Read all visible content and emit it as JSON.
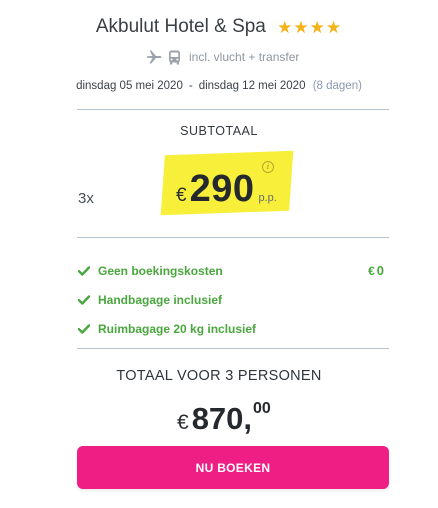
{
  "hotel": {
    "name": "Akbulut Hotel & Spa",
    "stars": 4
  },
  "transport": {
    "icons": [
      "plane-icon",
      "bus-icon"
    ],
    "text": "incl. vlucht + transfer"
  },
  "dates": {
    "from": "dinsdag 05 mei 2020",
    "separator": "-",
    "to": "dinsdag 12 mei 2020",
    "duration": "(8 dagen)"
  },
  "subtotal": {
    "label": "SUBTOTAAL",
    "quantity": "3x",
    "currency": "€",
    "price": "290",
    "per_person": "p.p."
  },
  "features": [
    {
      "label": "Geen boekingskosten",
      "currency": "€",
      "amount": "0"
    },
    {
      "label": "Handbagage inclusief"
    },
    {
      "label": "Ruimbagage 20 kg inclusief"
    }
  ],
  "total": {
    "label": "TOTAAL VOOR 3 PERSONEN",
    "currency": "€",
    "integer": "870,",
    "decimals": "00"
  },
  "book_button": {
    "label": "NU BOEKEN"
  },
  "colors": {
    "accent": "#ee1e85",
    "highlight": "#f7ee2f",
    "check": "#4aa63e",
    "star": "#f2b31b"
  }
}
